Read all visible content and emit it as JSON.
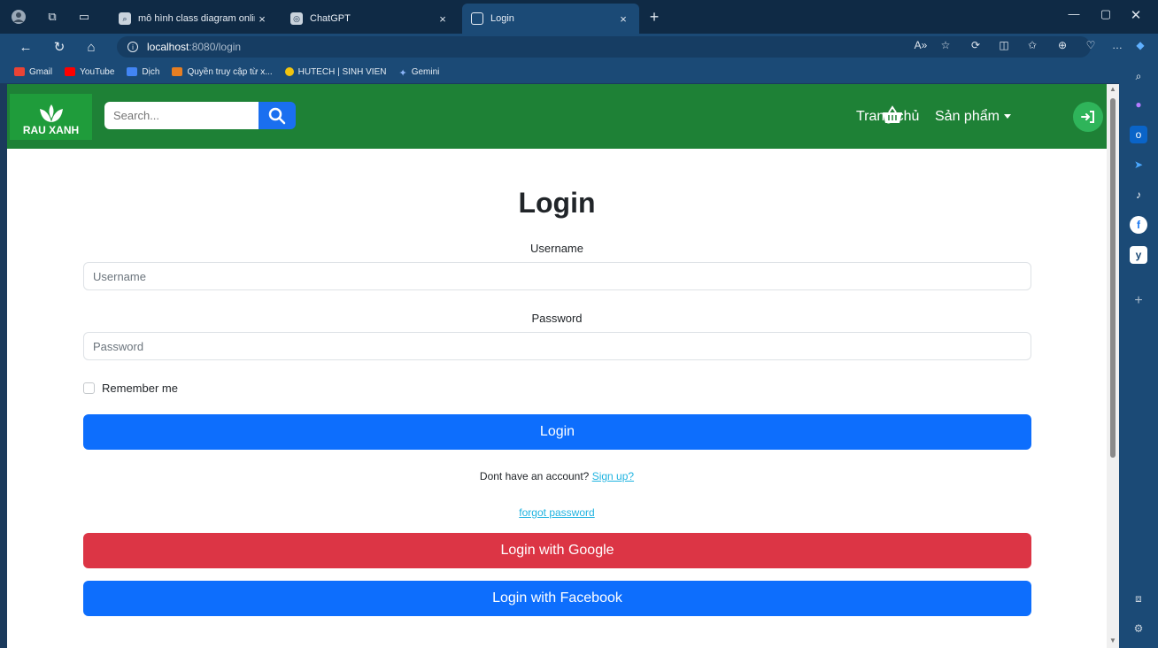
{
  "browser": {
    "tabs": [
      {
        "title": "mô hình class diagram online - T"
      },
      {
        "title": "ChatGPT"
      },
      {
        "title": "Login"
      }
    ],
    "url_host": "localhost",
    "url_path": ":8080/login",
    "bookmarks": [
      {
        "label": "Gmail",
        "color": "#ea4335"
      },
      {
        "label": "YouTube",
        "color": "#ff0000"
      },
      {
        "label": "Dịch",
        "color": "#4285f4"
      },
      {
        "label": "Quyền truy cập từ x...",
        "color": "#e67e22"
      },
      {
        "label": "HUTECH | SINH VIEN",
        "color": "#f1c40f"
      },
      {
        "label": "Gemini",
        "color": "#8ab4f8"
      }
    ]
  },
  "site": {
    "logo_text": "RAU XANH",
    "search_placeholder": "Search...",
    "nav": {
      "home": "Trang chủ",
      "products": "Sản phẩm"
    }
  },
  "form": {
    "title": "Login",
    "username_label": "Username",
    "username_placeholder": "Username",
    "password_label": "Password",
    "password_placeholder": "Password",
    "remember_label": "Remember me",
    "login_button": "Login",
    "signup_prompt": "Dont have an account?",
    "signup_link": "Sign up?",
    "forgot_link": "forgot password",
    "google_button": "Login with Google",
    "facebook_button": "Login with Facebook"
  },
  "colors": {
    "header_green": "#1e8136",
    "primary": "#0d6efd",
    "danger": "#dc3545"
  }
}
